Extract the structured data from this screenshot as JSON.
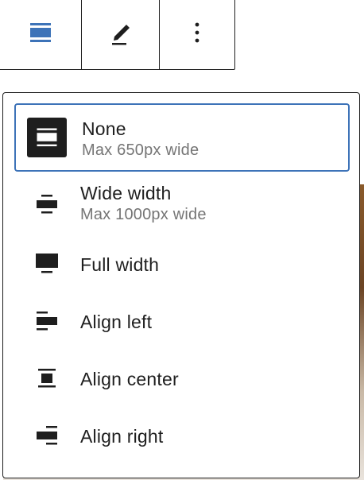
{
  "toolbar": {
    "buttons": [
      {
        "name": "align-button",
        "icon": "align-none-icon"
      },
      {
        "name": "edit-button",
        "icon": "pencil-icon"
      },
      {
        "name": "more-options-button",
        "icon": "more-vertical-icon"
      }
    ],
    "more_label": "⋮"
  },
  "dropdown": {
    "options": [
      {
        "label": "None",
        "sub": "Max 650px wide",
        "icon": "align-none-icon",
        "selected": true
      },
      {
        "label": "Wide width",
        "sub": "Max 1000px wide",
        "icon": "align-wide-icon",
        "selected": false
      },
      {
        "label": "Full width",
        "sub": "",
        "icon": "align-full-icon",
        "selected": false
      },
      {
        "label": "Align left",
        "sub": "",
        "icon": "align-left-icon",
        "selected": false
      },
      {
        "label": "Align center",
        "sub": "",
        "icon": "align-center-icon",
        "selected": false
      },
      {
        "label": "Align right",
        "sub": "",
        "icon": "align-right-icon",
        "selected": false
      }
    ]
  },
  "colors": {
    "accent": "#3d73b8",
    "text": "#1e1e1e",
    "muted": "#757575",
    "border": "#1e1e1e"
  }
}
